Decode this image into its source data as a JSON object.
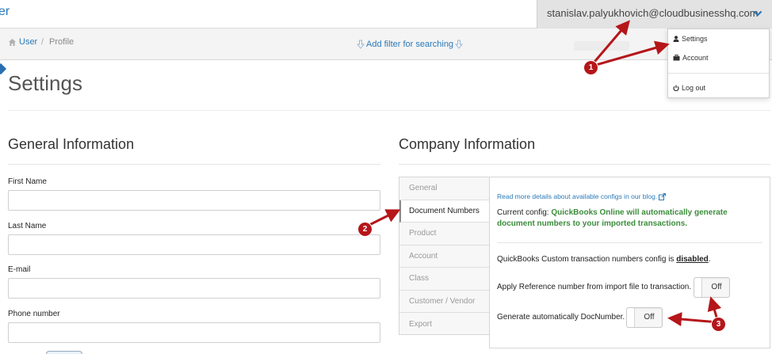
{
  "topbar": {
    "brand": "er",
    "user_email": "stanislav.palyukhovich@cloudbusinesshq.com",
    "caret_icon": "chevron-down-icon"
  },
  "breadcrumb": {
    "home_icon": "home-icon",
    "user": "User",
    "separator": "/",
    "profile": "Profile",
    "filter_link": "Add filter for searching"
  },
  "dropdown": {
    "items": [
      {
        "icon": "user-icon",
        "label": "Settings"
      },
      {
        "icon": "briefcase-icon",
        "label": "Account"
      },
      {
        "icon": "power-icon",
        "label": "Log out"
      }
    ]
  },
  "page": {
    "title": "Settings"
  },
  "general": {
    "title": "General Information",
    "fields": [
      {
        "label": "First Name",
        "value": ""
      },
      {
        "label": "Last Name",
        "value": ""
      },
      {
        "label": "E-mail",
        "value": ""
      },
      {
        "label": "Phone number",
        "value": ""
      }
    ]
  },
  "company": {
    "title": "Company Information",
    "tabs": [
      "General",
      "Document Numbers",
      "Product",
      "Account",
      "Class",
      "Customer / Vendor",
      "Export"
    ],
    "active_tab": "Document Numbers",
    "link": "Read more details about available configs in our blog.",
    "current_prefix": "Current config: ",
    "current_value": "QuickBooks Online will automatically generate document numbers to your imported transactions.",
    "custom_prefix": "QuickBooks Custom transaction numbers config is ",
    "custom_status": "disabled",
    "custom_suffix": ".",
    "apply_ref_label": "Apply Reference number from import file to transaction.",
    "apply_ref_state": "Off",
    "gen_doc_label": "Generate automatically DocNumber.",
    "gen_doc_state": "Off"
  },
  "annotations": {
    "badges": [
      "1",
      "2",
      "3"
    ],
    "color": "#b5161a"
  },
  "colors": {
    "link": "#2a7ab9",
    "success_text": "#3c8d3c",
    "annotation": "#b5161a"
  }
}
